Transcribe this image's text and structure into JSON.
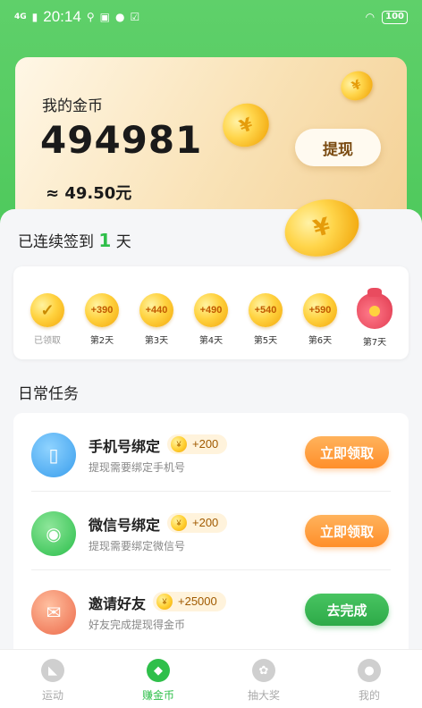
{
  "status_bar": {
    "network": "4G",
    "time": "20:14",
    "battery": "100"
  },
  "coin_card": {
    "title": "我的金币",
    "coins": "494981",
    "rmb": "≈ 49.50元",
    "withdraw_label": "提现"
  },
  "checkin": {
    "title_prefix": "已连续签到",
    "streak_days": "1",
    "title_suffix": "天",
    "days": [
      {
        "amount": "✓",
        "label": "已领取",
        "state": "claimed"
      },
      {
        "amount": "+390",
        "label": "第2天"
      },
      {
        "amount": "+440",
        "label": "第3天"
      },
      {
        "amount": "+490",
        "label": "第4天"
      },
      {
        "amount": "+540",
        "label": "第5天"
      },
      {
        "amount": "+590",
        "label": "第6天"
      },
      {
        "amount": "",
        "label": "第7天",
        "state": "gift-bag"
      }
    ]
  },
  "daily_tasks": {
    "title": "日常任务",
    "items": [
      {
        "name": "手机号绑定",
        "reward": "+200",
        "desc": "提现需要绑定手机号",
        "action": "立即领取",
        "icon": "phone-icon",
        "icon_color": "#4aa8f0"
      },
      {
        "name": "微信号绑定",
        "reward": "+200",
        "desc": "提现需要绑定微信号",
        "action": "立即领取",
        "icon": "wechat-icon",
        "icon_color": "#3ec65a"
      },
      {
        "name": "邀请好友",
        "reward": "+25000",
        "desc": "好友完成提现得金币",
        "action": "去完成",
        "icon": "invite-icon",
        "icon_color": "#f07a5a"
      }
    ]
  },
  "bottom_nav": [
    {
      "label": "运动",
      "icon": "sneaker-icon"
    },
    {
      "label": "赚金币",
      "icon": "coin-icon",
      "active": true
    },
    {
      "label": "抽大奖",
      "icon": "prize-icon"
    },
    {
      "label": "我的",
      "icon": "profile-icon"
    }
  ],
  "colors": {
    "brand_green": "#4cc85a",
    "accent_orange": "#ff8f2a",
    "gold": "#ffd23f"
  }
}
